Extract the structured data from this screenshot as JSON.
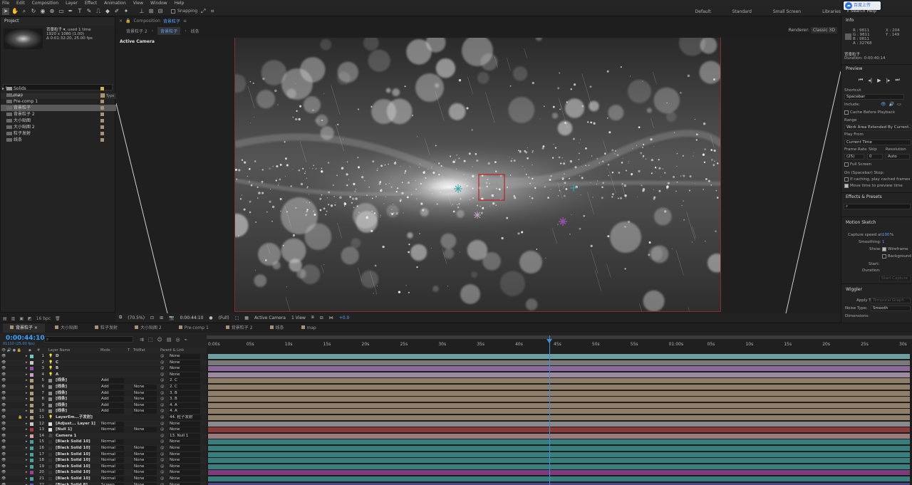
{
  "menu": [
    "File",
    "Edit",
    "Composition",
    "Layer",
    "Effect",
    "Animation",
    "View",
    "Window",
    "Help"
  ],
  "toolbar": {
    "tools": [
      "selection-tool",
      "hand-tool",
      "zoom-tool",
      "rotate-tool",
      "unified-camera-tool",
      "pan-behind-tool",
      "rectangle-tool",
      "pen-tool",
      "type-tool",
      "brush-tool",
      "clone-stamp-tool",
      "eraser-tool",
      "roto-brush-tool",
      "puppet-tool"
    ],
    "snapping": "Snapping",
    "workspaces": [
      "Default",
      "Standard",
      "Small Screen",
      "Libraries"
    ],
    "upload": "百度上传",
    "search_help": "Search Help"
  },
  "project": {
    "title": "Project",
    "item_name": "背景粒子 ▾",
    "used": ", used 1 time",
    "size": "1920 x 1080 (1.00)",
    "duration": "Δ 0:01:32:20, 25.00 fps",
    "col_name": "Name",
    "col_type": "Type",
    "items": [
      "Solids",
      "map",
      "Pre-comp 1",
      "背景粒子",
      "背景粒子 2",
      "大小贴图",
      "大小贴图 2",
      "粒子发射",
      "线条"
    ],
    "bpc": "16 bpc"
  },
  "composition": {
    "tab_label": "Composition",
    "tab_name": "背景粒子",
    "breadcrumbs": [
      "背景粒子 2",
      "背景粒子",
      "线条"
    ],
    "renderer_label": "Renderer:",
    "renderer": "Classic 3D",
    "active_camera_label": "Active Camera",
    "footer": {
      "zoom": "(70.5%)",
      "time": "0:00:44:10",
      "resolution": "(Full)",
      "camera": "Active Camera",
      "view": "1 View",
      "exposure": "+0.0"
    }
  },
  "info": {
    "title": "Info",
    "r": "R : 9811",
    "g": "G : 9811",
    "b": "B : 9811",
    "a": "A : 32768",
    "x": "X : 204",
    "y": "Y : 149",
    "comp": "背景粒子",
    "duration": "Duration: 0:00:40:14"
  },
  "preview": {
    "title": "Preview",
    "shortcut_label": "Shortcut",
    "shortcut": "Spacebar",
    "include_label": "Include:",
    "cache": "Cache Before Playback",
    "range_label": "Range",
    "range": "Work Area Extended By Current...",
    "playfrom_label": "Play From",
    "playfrom": "Current Time",
    "framerate_label": "Frame Rate",
    "skip_label": "Skip",
    "resolution_label": "Resolution",
    "framerate": "(25)",
    "skip": "0",
    "resolution": "Auto",
    "fullscreen": "Full Screen",
    "stop_label": "On (Spacebar) Stop:",
    "if_caching": "If caching, play cached frames",
    "move_time": "Move time to preview time"
  },
  "effects": {
    "title": "Effects & Presets"
  },
  "motion_sketch": {
    "title": "Motion Sketch",
    "capture_label": "Capture speed at:",
    "capture_value": "100",
    "capture_unit": "%",
    "smoothing_label": "Smoothing:",
    "smoothing": "1",
    "show_label": "Show:",
    "wireframe": "Wireframe",
    "background": "Background",
    "start_label": "Start:",
    "duration_label": "Duration:",
    "start_capture": "Start Capture"
  },
  "wiggler": {
    "title": "Wiggler",
    "apply_label": "Apply To:",
    "apply": "Temporal Graph",
    "noise_label": "Noise Type:",
    "noise": "Smooth",
    "dimensions_label": "Dimensions:"
  },
  "timeline": {
    "tabs": [
      "背景粒子",
      "大小贴图",
      "粒子发射",
      "大小贴图 2",
      "Pre-comp 1",
      "背景粒子 2",
      "线条",
      "map"
    ],
    "timecode": "0:00:44:10",
    "timecode_sub": "01110 (25.00 fps)",
    "col_layer": "Layer Name",
    "col_mode": "Mode",
    "col_t": "T",
    "col_trkmat": "TrkMat",
    "col_parent": "Parent & Link",
    "ticks": [
      "0:00s",
      "05s",
      "10s",
      "15s",
      "20s",
      "25s",
      "30s",
      "35s",
      "40s",
      "45s",
      "50s",
      "55s",
      "01:00s",
      "05s",
      "10s",
      "15s",
      "20s",
      "25s",
      "30s"
    ],
    "layers": [
      {
        "num": "1",
        "name": "D",
        "color": "#6fc8c8",
        "type": "light",
        "mode": "",
        "trk": "",
        "parent": "None"
      },
      {
        "num": "2",
        "name": "C",
        "color": "#c8c8c8",
        "type": "light",
        "mode": "",
        "trk": "",
        "parent": "None"
      },
      {
        "num": "3",
        "name": "B",
        "color": "#9a4fa8",
        "type": "light",
        "mode": "",
        "trk": "",
        "parent": "None"
      },
      {
        "num": "4",
        "name": "A",
        "color": "#c8a0c8",
        "type": "light",
        "mode": "",
        "trk": "",
        "parent": "None"
      },
      {
        "num": "5",
        "name": "[线条]",
        "color": "#b49a7a",
        "type": "comp",
        "mode": "Add",
        "trk": "",
        "parent": "2. C"
      },
      {
        "num": "6",
        "name": "[线条]",
        "color": "#b49a7a",
        "type": "comp",
        "mode": "Add",
        "trk": "None",
        "parent": "2. C"
      },
      {
        "num": "7",
        "name": "[线条]",
        "color": "#b49a7a",
        "type": "comp",
        "mode": "Add",
        "trk": "None",
        "parent": "3. B"
      },
      {
        "num": "8",
        "name": "[线条]",
        "color": "#b49a7a",
        "type": "comp",
        "mode": "Add",
        "trk": "None",
        "parent": "3. B"
      },
      {
        "num": "9",
        "name": "[线条]",
        "color": "#b49a7a",
        "type": "comp",
        "mode": "Add",
        "trk": "None",
        "parent": "4. A"
      },
      {
        "num": "10",
        "name": "[线条]",
        "color": "#b49a7a",
        "type": "comp",
        "mode": "Add",
        "trk": "None",
        "parent": "4. A"
      },
      {
        "num": "11",
        "name": "LayerEm...子发射]",
        "color": "#b49a7a",
        "type": "light",
        "mode": "",
        "trk": "",
        "parent": "44. 粒子发射"
      },
      {
        "num": "12",
        "name": "[Adjust... Layer 1]",
        "color": "#c8c8c8",
        "type": "solid",
        "mode": "Normal",
        "trk": "",
        "parent": "None"
      },
      {
        "num": "13",
        "name": "[Null 1]",
        "color": "#b03a3a",
        "type": "solid",
        "mode": "Normal",
        "trk": "None",
        "parent": "None"
      },
      {
        "num": "14",
        "name": "Camera 1",
        "color": "#d8a0a0",
        "type": "camera",
        "mode": "",
        "trk": "",
        "parent": "13. Null 1"
      },
      {
        "num": "15",
        "name": "[Black Solid 10]",
        "color": "#4aa0a0",
        "type": "solid",
        "mode": "Normal",
        "trk": "",
        "parent": "None"
      },
      {
        "num": "16",
        "name": "[Black Solid 10]",
        "color": "#4aa0a0",
        "type": "solid",
        "mode": "Normal",
        "trk": "None",
        "parent": "None"
      },
      {
        "num": "17",
        "name": "[Black Solid 10]",
        "color": "#4aa0a0",
        "type": "solid",
        "mode": "Normal",
        "trk": "None",
        "parent": "None"
      },
      {
        "num": "18",
        "name": "[Black Solid 10]",
        "color": "#4aa0a0",
        "type": "solid",
        "mode": "Normal",
        "trk": "None",
        "parent": "None"
      },
      {
        "num": "19",
        "name": "[Black Solid 10]",
        "color": "#4aa0a0",
        "type": "solid",
        "mode": "Normal",
        "trk": "None",
        "parent": "None"
      },
      {
        "num": "20",
        "name": "[Black Solid 10]",
        "color": "#9a3f9a",
        "type": "solid",
        "mode": "Normal",
        "trk": "None",
        "parent": "None"
      },
      {
        "num": "21",
        "name": "[Black Solid 10]",
        "color": "#4aa0a0",
        "type": "solid",
        "mode": "Normal",
        "trk": "None",
        "parent": "None"
      },
      {
        "num": "22",
        "name": "[Black Solid 8]",
        "color": "#5a5ab8",
        "type": "solid",
        "mode": "Screen",
        "trk": "None",
        "parent": "None"
      }
    ],
    "bar_colors": [
      "#6b9fa0",
      "#7a7a7a",
      "#8a6a9a",
      "#9c8aa0",
      "#8f7f6a",
      "#8f7f6a",
      "#8f7f6a",
      "#8f7f6a",
      "#8f7f6a",
      "#8f7f6a",
      "#8f7f6a",
      "#8a8a8a",
      "#8a3a3a",
      "#9a7a7a",
      "#3a7d7d",
      "#3a7d7d",
      "#3a7d7d",
      "#3a7d7d",
      "#3a7d7d",
      "#7d3a7d",
      "#3a7d7d",
      "#4a4a8a"
    ],
    "playhead_position_seconds": 44.4,
    "visible_seconds": 90
  }
}
